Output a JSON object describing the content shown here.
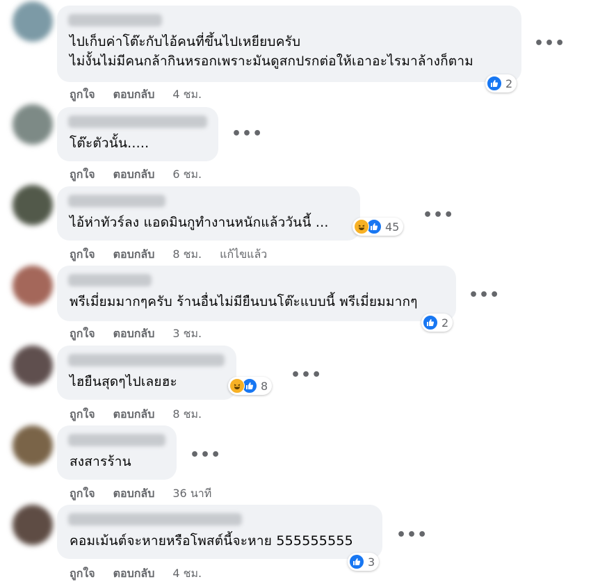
{
  "colors": {
    "bubble": "#f0f2f5",
    "like": "#1877f2",
    "haha": "#f7b125",
    "meta": "#65676b"
  },
  "comments": [
    {
      "lines": [
        "ไปเก็บค่าโต๊ะกับไอ้คนที่ขึ้นไปเหยียบครับ",
        "ไม่งั้นไม่มีคนกล้ากินหรอกเพราะมันดูสกปรกต่อให้เอาอะไรมาล้างก็ตาม"
      ],
      "like": "ถูกใจ",
      "reply": "ตอบกลับ",
      "time": "4 ชม.",
      "edited": "",
      "reactions": [
        "like-icon"
      ],
      "count": "2"
    },
    {
      "lines": [
        "โต๊ะตัวนั้น....."
      ],
      "like": "ถูกใจ",
      "reply": "ตอบกลับ",
      "time": "6 ชม.",
      "edited": "",
      "reactions": [],
      "count": ""
    },
    {
      "lines": [
        "ไอ้ห่าทัวร์ลง แอดมินกูทำงานหนักแล้ววันนี้ ..."
      ],
      "like": "ถูกใจ",
      "reply": "ตอบกลับ",
      "time": "8 ชม.",
      "edited": "แก้ไขแล้ว",
      "reactions": [
        "haha-icon",
        "like-icon"
      ],
      "count": "45"
    },
    {
      "lines": [
        "พรีเมี่ยมมากๆครับ ร้านอื่นไม่มียืนบนโต๊ะแบบนี้ พรีเมี่ยมมากๆ"
      ],
      "like": "ถูกใจ",
      "reply": "ตอบกลับ",
      "time": "3 ชม.",
      "edited": "",
      "reactions": [
        "like-icon"
      ],
      "count": "2"
    },
    {
      "lines": [
        "ไฮยืนสุดๆไปเลยฮะ"
      ],
      "like": "ถูกใจ",
      "reply": "ตอบกลับ",
      "time": "8 ชม.",
      "edited": "",
      "reactions": [
        "haha-icon",
        "like-icon"
      ],
      "count": "8"
    },
    {
      "lines": [
        "สงสารร้าน"
      ],
      "like": "ถูกใจ",
      "reply": "ตอบกลับ",
      "time": "36 นาที",
      "edited": "",
      "reactions": [],
      "count": ""
    },
    {
      "lines": [
        "คอมเม้นต์จะหายหรือโพสต์นี้จะหาย 555555555"
      ],
      "like": "ถูกใจ",
      "reply": "ตอบกลับ",
      "time": "4 ชม.",
      "edited": "",
      "reactions": [
        "like-icon"
      ],
      "count": "3"
    }
  ]
}
